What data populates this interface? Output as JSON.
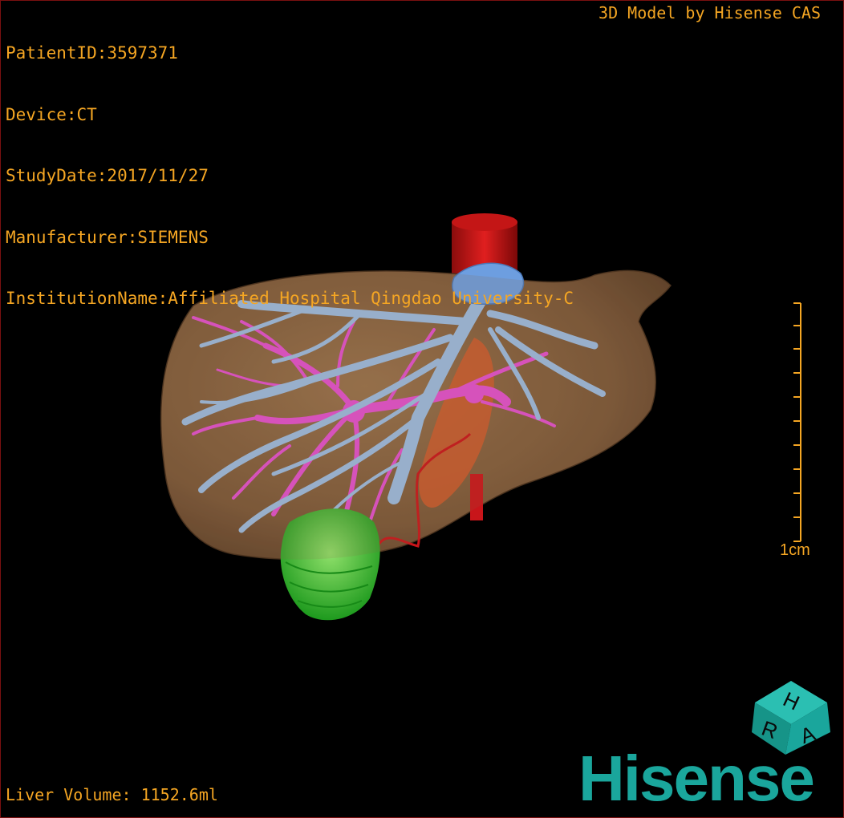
{
  "overlay": {
    "patient_id": "PatientID:3597371",
    "device": "Device:CT",
    "study_date": "StudyDate:2017/11/27",
    "manufacturer": "Manufacturer:SIEMENS",
    "institution": "InstitutionName:Affiliated Hospital Qingdao University-C",
    "credit": "3D Model by Hisense CAS",
    "liver_volume": "Liver Volume: 1152.6ml"
  },
  "scale_bar": {
    "label": "1cm"
  },
  "orientation_cube": {
    "faces": [
      "H",
      "R",
      "A"
    ],
    "color": "#1aa69c"
  },
  "brand": {
    "logo_text": "Hisense",
    "color": "#1aa69c"
  },
  "colors": {
    "text": "#f5a623",
    "liver": "#8a6440",
    "hepatic_vein": "#9bbde3",
    "portal_vein": "#e34fd0",
    "artery": "#c8151a",
    "tumor": "#22c22a",
    "gallbladder": "#d35a2a"
  }
}
